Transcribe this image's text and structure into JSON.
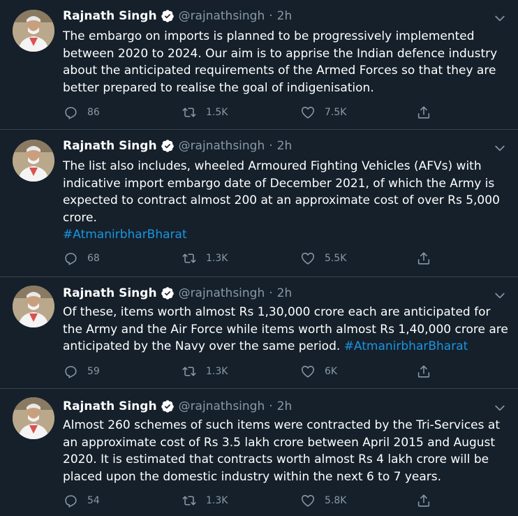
{
  "tweets": [
    {
      "name": "Rajnath Singh",
      "handle": "@rajnathsingh",
      "separator": "·",
      "time": "2h",
      "text": "The embargo on imports is planned to be progressively implemented between 2020 to 2024. Our aim is to apprise the Indian defence industry about the anticipated requirements of the Armed Forces so that they are better prepared to realise the goal of indigenisation.",
      "hashtag": "",
      "replies": "86",
      "retweets": "1.5K",
      "likes": "7.5K"
    },
    {
      "name": "Rajnath Singh",
      "handle": "@rajnathsingh",
      "separator": "·",
      "time": "2h",
      "text": "The list also includes, wheeled Armoured Fighting Vehicles (AFVs) with indicative import embargo date of December 2021, of which the Army is expected to contract almost 200 at an approximate cost of over Rs 5,000 crore.",
      "hashtag": "#AtmanirbharBharat",
      "replies": "68",
      "retweets": "1.3K",
      "likes": "5.5K"
    },
    {
      "name": "Rajnath Singh",
      "handle": "@rajnathsingh",
      "separator": "·",
      "time": "2h",
      "text": "Of these, items worth almost Rs 1,30,000 crore each are anticipated for the Army and the Air Force while items worth almost Rs 1,40,000 crore are anticipated by the Navy over the same period.",
      "hashtag": "#AtmanirbharBharat",
      "replies": "59",
      "retweets": "1.3K",
      "likes": "6K"
    },
    {
      "name": "Rajnath Singh",
      "handle": "@rajnathsingh",
      "separator": "·",
      "time": "2h",
      "text": "Almost 260 schemes of such items were contracted by the Tri-Services at an approximate cost of Rs 3.5 lakh crore between April 2015 and August 2020. It is estimated that contracts worth almost Rs 4 lakh crore will be placed upon the domestic industry within the next 6 to 7 years.",
      "hashtag": "",
      "replies": "54",
      "retweets": "1.3K",
      "likes": "5.8K"
    }
  ],
  "icons": {
    "verified": "verified-badge-icon",
    "more": "chevron-down-icon",
    "reply": "reply-icon",
    "retweet": "retweet-icon",
    "like": "heart-icon",
    "share": "share-icon"
  },
  "colors": {
    "background": "#15202b",
    "divider": "#38444d",
    "text": "#ffffff",
    "muted": "#8899a6",
    "accent": "#1b95e0"
  }
}
